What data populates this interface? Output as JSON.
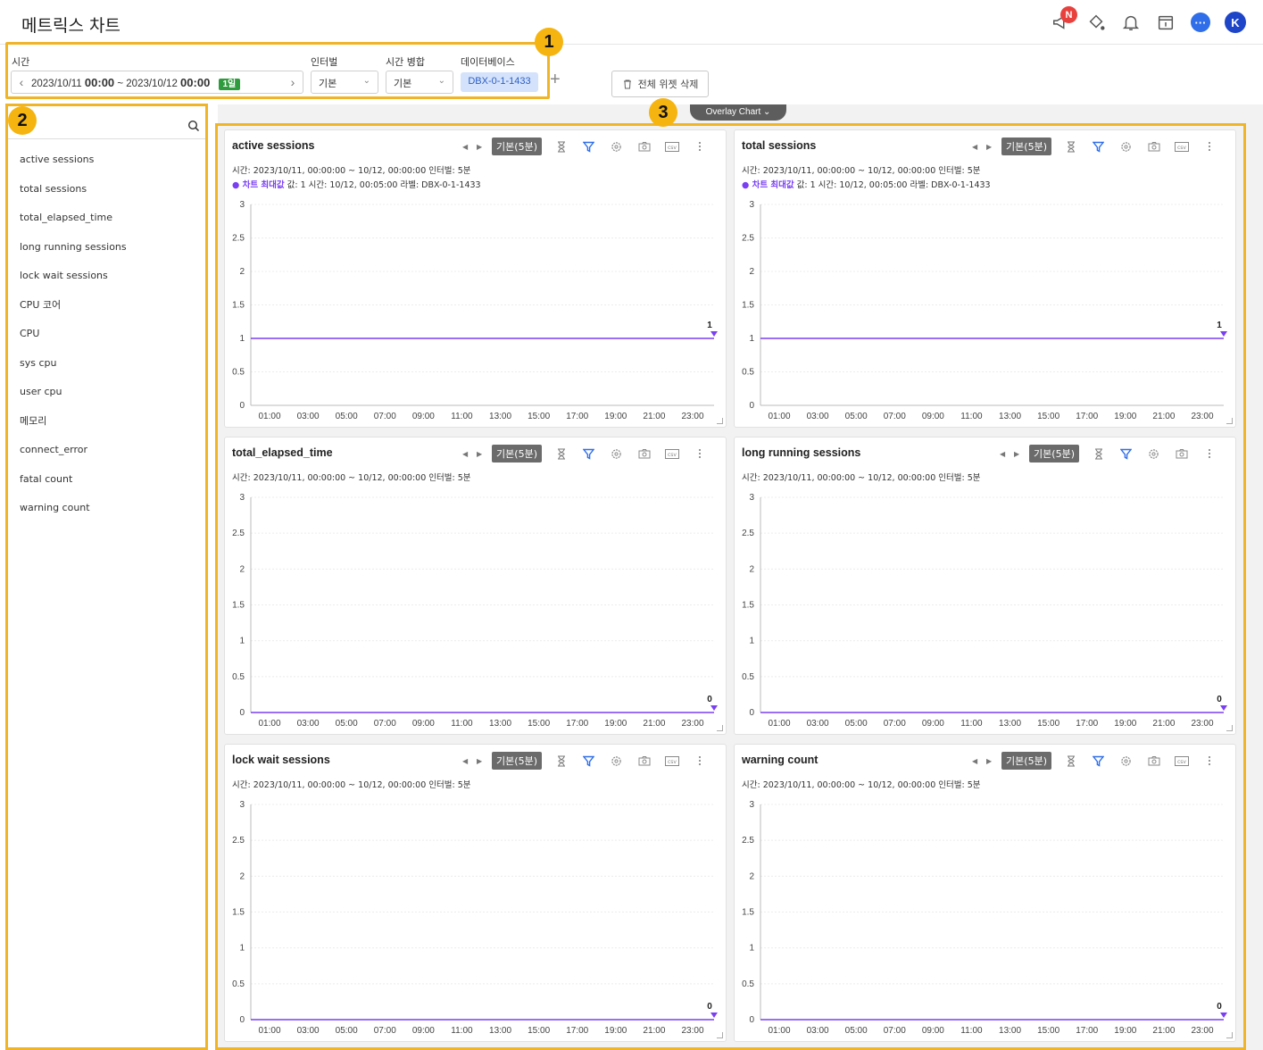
{
  "page": {
    "title": "메트릭스 차트"
  },
  "header": {
    "notice_badge": "N",
    "avatar_initial": "K",
    "icons": [
      "megaphone-icon",
      "paint-bucket-icon",
      "bell-icon",
      "calendar-icon",
      "chat-icon"
    ]
  },
  "toolbar": {
    "time_label": "시간",
    "interval_label": "인터벌",
    "merge_label": "시간 병합",
    "database_label": "데이터베이스",
    "range_start_date": "2023/10/11",
    "range_start_time": "00:00",
    "range_sep": "~",
    "range_end_date": "2023/10/12",
    "range_end_time": "00:00",
    "range_badge": "1일",
    "interval_value": "기본",
    "merge_value": "기본",
    "database_value": "DBX-0-1-1433",
    "delete_all_label": "전체 위젯 삭제"
  },
  "annotations": {
    "one": "1",
    "two": "2",
    "three": "3"
  },
  "overlay": {
    "label": "Overlay Chart ⌄"
  },
  "sidebar": {
    "items": [
      "active sessions",
      "total sessions",
      "total_elapsed_time",
      "long running sessions",
      "lock wait sessions",
      "CPU 코어",
      "CPU",
      "sys cpu",
      "user cpu",
      "메모리",
      "connect_error",
      "fatal count",
      "warning count"
    ]
  },
  "colors": {
    "accent": "#f0b429",
    "line": "#7a3ff2",
    "filter": "#2f6ee8"
  },
  "card_common": {
    "badge": "기본(5분)",
    "info": "시간: 2023/10/11, 00:00:00 ~ 10/12, 00:00:00  인터벌: 5분",
    "max_label": "● 차트 최대값",
    "max_detail": "값: 1   시간: 10/12, 00:05:00   라벨: DBX-0-1-1433"
  },
  "charts": [
    {
      "title": "active sessions",
      "show_max": true,
      "has_csv": true
    },
    {
      "title": "total sessions",
      "show_max": true,
      "has_csv": true
    },
    {
      "title": "total_elapsed_time",
      "show_max": false,
      "has_csv": true
    },
    {
      "title": "long running sessions",
      "show_max": false,
      "has_csv": false
    },
    {
      "title": "lock wait sessions",
      "show_max": false,
      "has_csv": true
    },
    {
      "title": "warning count",
      "show_max": false,
      "has_csv": true
    }
  ],
  "chart_data": [
    {
      "type": "line",
      "title": "active sessions",
      "x": [
        "01:00",
        "03:00",
        "05:00",
        "07:00",
        "09:00",
        "11:00",
        "13:00",
        "15:00",
        "17:00",
        "19:00",
        "21:00",
        "23:00"
      ],
      "y_ticks": [
        "0",
        "0.5",
        "1",
        "1.5",
        "2",
        "2.5",
        "3"
      ],
      "ylim": [
        0,
        3
      ],
      "series": [
        {
          "values": [
            1,
            1,
            1,
            1,
            1,
            1,
            1,
            1,
            1,
            1,
            1,
            1
          ]
        }
      ],
      "end_label": "1"
    },
    {
      "type": "line",
      "title": "total sessions",
      "x": [
        "01:00",
        "03:00",
        "05:00",
        "07:00",
        "09:00",
        "11:00",
        "13:00",
        "15:00",
        "17:00",
        "19:00",
        "21:00",
        "23:00"
      ],
      "y_ticks": [
        "0",
        "0.5",
        "1",
        "1.5",
        "2",
        "2.5",
        "3"
      ],
      "ylim": [
        0,
        3
      ],
      "series": [
        {
          "values": [
            1,
            1,
            1,
            1,
            1,
            1,
            1,
            1,
            1,
            1,
            1,
            1
          ]
        }
      ],
      "end_label": "1"
    },
    {
      "type": "line",
      "title": "total_elapsed_time",
      "x": [
        "01:00",
        "03:00",
        "05:00",
        "07:00",
        "09:00",
        "11:00",
        "13:00",
        "15:00",
        "17:00",
        "19:00",
        "21:00",
        "23:00"
      ],
      "y_ticks": [
        "0",
        "0.5",
        "1",
        "1.5",
        "2",
        "2.5",
        "3"
      ],
      "ylim": [
        0,
        3
      ],
      "series": [
        {
          "values": [
            0,
            0,
            0,
            0,
            0,
            0,
            0,
            0,
            0,
            0,
            0,
            0
          ]
        }
      ],
      "end_label": "0"
    },
    {
      "type": "line",
      "title": "long running sessions",
      "x": [
        "01:00",
        "03:00",
        "05:00",
        "07:00",
        "09:00",
        "11:00",
        "13:00",
        "15:00",
        "17:00",
        "19:00",
        "21:00",
        "23:00"
      ],
      "y_ticks": [
        "0",
        "0.5",
        "1",
        "1.5",
        "2",
        "2.5",
        "3"
      ],
      "ylim": [
        0,
        3
      ],
      "series": [
        {
          "values": [
            0,
            0,
            0,
            0,
            0,
            0,
            0,
            0,
            0,
            0,
            0,
            0
          ]
        }
      ],
      "end_label": "0"
    },
    {
      "type": "line",
      "title": "lock wait sessions",
      "x": [
        "01:00",
        "03:00",
        "05:00",
        "07:00",
        "09:00",
        "11:00",
        "13:00",
        "15:00",
        "17:00",
        "19:00",
        "21:00",
        "23:00"
      ],
      "y_ticks": [
        "0",
        "0.5",
        "1",
        "1.5",
        "2",
        "2.5",
        "3"
      ],
      "ylim": [
        0,
        3
      ],
      "series": [
        {
          "values": [
            0,
            0,
            0,
            0,
            0,
            0,
            0,
            0,
            0,
            0,
            0,
            0
          ]
        }
      ],
      "end_label": "0"
    },
    {
      "type": "line",
      "title": "warning count",
      "x": [
        "01:00",
        "03:00",
        "05:00",
        "07:00",
        "09:00",
        "11:00",
        "13:00",
        "15:00",
        "17:00",
        "19:00",
        "21:00",
        "23:00"
      ],
      "y_ticks": [
        "0",
        "0.5",
        "1",
        "1.5",
        "2",
        "2.5",
        "3"
      ],
      "ylim": [
        0,
        3
      ],
      "series": [
        {
          "values": [
            0,
            0,
            0,
            0,
            0,
            0,
            0,
            0,
            0,
            0,
            0,
            0
          ]
        }
      ],
      "end_label": "0"
    }
  ]
}
